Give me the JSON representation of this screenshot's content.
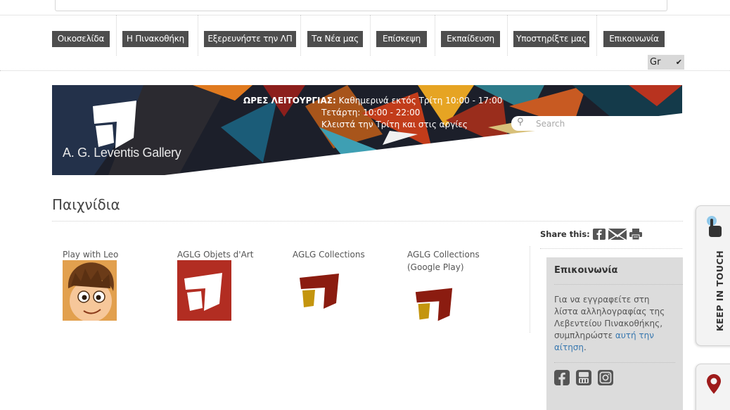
{
  "nav": {
    "items": [
      {
        "label": "Οικοσελίδα"
      },
      {
        "label": "Η Πινακοθήκη"
      },
      {
        "label": "Εξερευνήστε την ΛΠ"
      },
      {
        "label": "Τα Νέα μας"
      },
      {
        "label": "Επίσκεψη"
      },
      {
        "label": "Εκπαίδευση"
      },
      {
        "label": "Υποστηρίξτε μας"
      },
      {
        "label": "Επικοινωνία"
      }
    ],
    "language": "Gr"
  },
  "banner": {
    "hours_label": "ΩΡΕΣ ΛΕΙΤΟΥΡΓΙΑΣ:",
    "hours_line1": "Καθημερινά εκτός Τρίτη 10:00 - 17:00",
    "hours_line2": "Τετάρτη: 10:00 - 22:00",
    "hours_line3": "Κλειστά την Τρίτη και στις αργίες",
    "logo_text": "A. G. Leventis Gallery",
    "search_placeholder": "Search"
  },
  "page": {
    "title": "Παιχνίδια"
  },
  "share": {
    "label": "Share this:"
  },
  "games": [
    {
      "name": "Play with Leo",
      "icon": "leo-avatar-icon"
    },
    {
      "name": "AGLG Objets d'Art",
      "icon": "aglg-red-logo-icon"
    },
    {
      "name": "AGLG Collections",
      "icon": "aglg-collections-logo-icon"
    },
    {
      "name": "AGLG Collections (Google Play)",
      "icon": "aglg-collections-logo-icon"
    }
  ],
  "contact": {
    "title": "Επικοινωνία",
    "text": "Για να εγγραφείτε στη λίστα αλληλογραφίας της Λεβεντείου Πινακοθήκης, συμπληρώστε ",
    "link": "αυτή την αίτηση",
    "suffix": "."
  },
  "side_tabs": {
    "keep_in_touch": "KEEP IN TOUCH"
  },
  "colors": {
    "nav_bg": "#4d4d4d",
    "accent_red": "#b22d22",
    "logo_dark_red": "#8b1c10",
    "logo_gold": "#c4950e",
    "link_blue": "#3a79b0",
    "sidebar_bg": "#dcdcdc"
  }
}
